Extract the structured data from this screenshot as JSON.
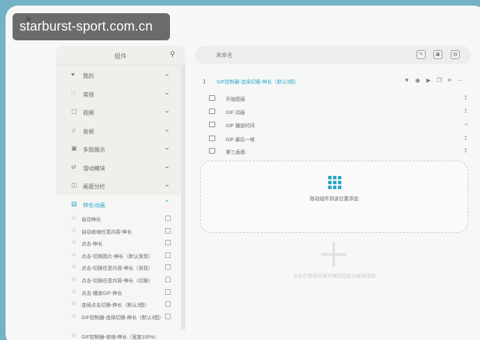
{
  "watermark": "starburst-sport.com.cn",
  "panel": {
    "title": "组件",
    "categories": [
      {
        "label": "我的",
        "icon": "heart-icon"
      },
      {
        "label": "常规",
        "icon": "grid-icon"
      },
      {
        "label": "视频",
        "icon": "video-icon"
      },
      {
        "label": "音频",
        "icon": "music-icon"
      },
      {
        "label": "多图展示",
        "icon": "images-icon"
      },
      {
        "label": "滑动模块",
        "icon": "slide-icon"
      },
      {
        "label": "画面分栏",
        "icon": "columns-icon"
      },
      {
        "label": "伸长动画",
        "icon": "expand-icon"
      }
    ],
    "subitems": [
      "自动伸长",
      "自动收缩任意内容-伸长",
      "点击-伸长",
      "点击-切换图片-伸长（默认渐现）",
      "点击-切换任意内容-伸长（渐现）",
      "点击-切换任意内容-伸长（切换）",
      "点击-播放GIF-伸长",
      "连续点击切换-伸长（默认3图）",
      "GIF控制器-连续切换-伸长（默认3图）",
      "GIF控制器-收缩-伸长（宽度100%）"
    ]
  },
  "canvas": {
    "name": "未命名",
    "selected_index": "1",
    "selected_title": "GIF控制器-连续切换-伸长（默认3图）",
    "layers": [
      "开始图层",
      "GIF 动画",
      "GIF 播放时间",
      "GIF 最后一帧",
      "第三画面"
    ],
    "dropzone_hint": "拖动组件到该位置添加",
    "bottom_hint": "点击左侧组件库并拖动至此以继续添加"
  }
}
